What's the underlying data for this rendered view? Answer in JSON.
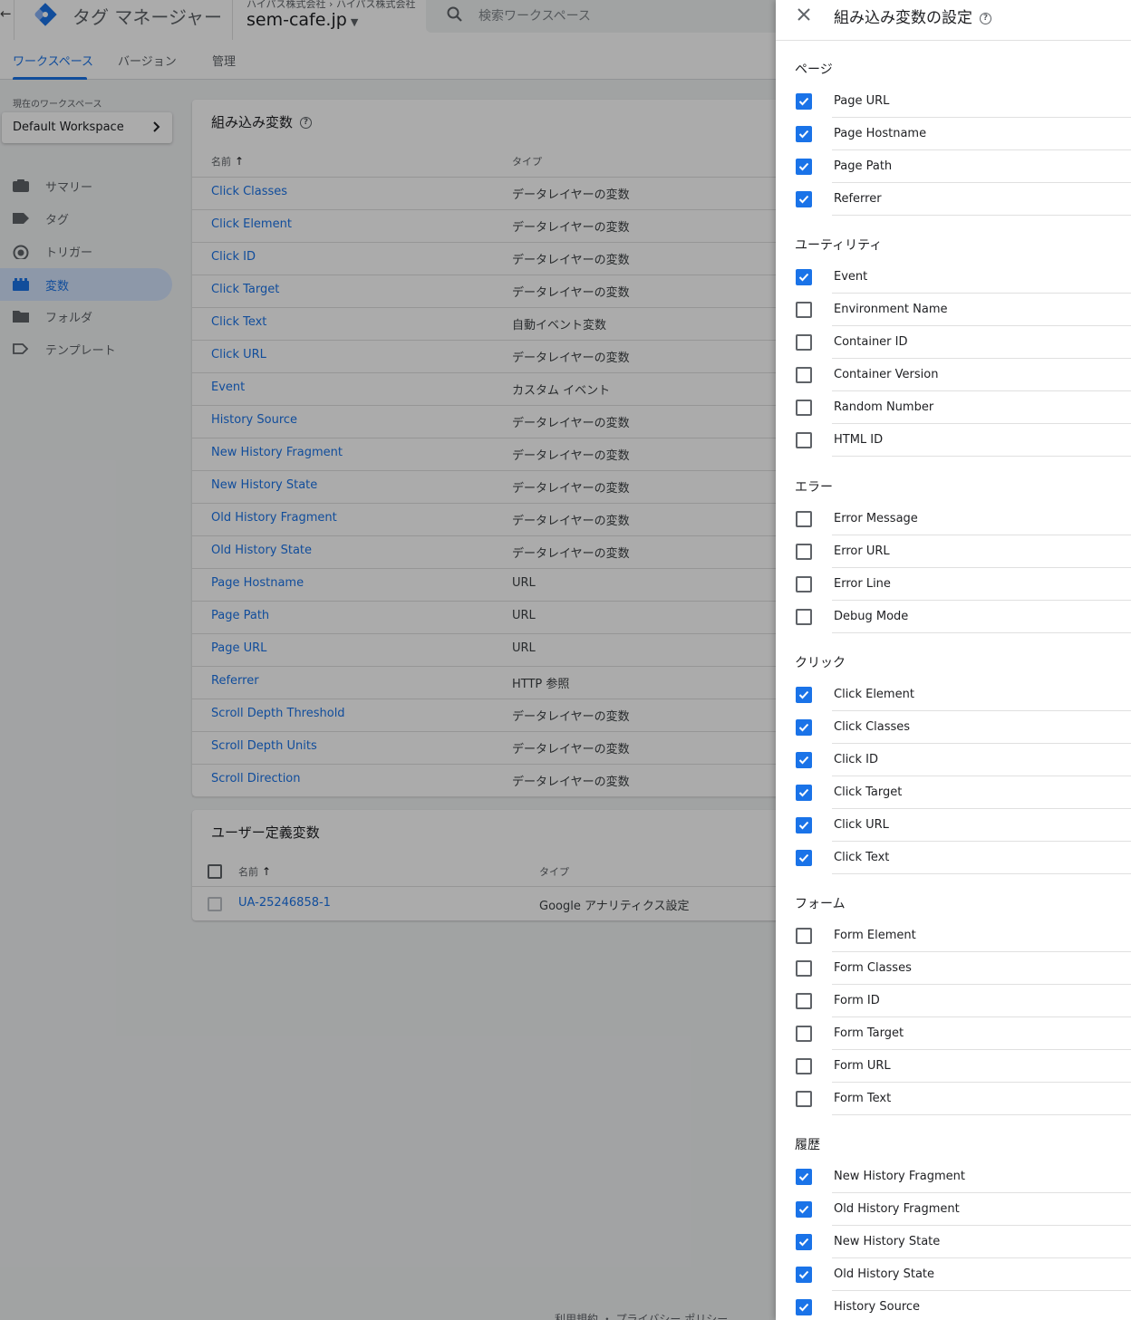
{
  "app": {
    "back_arrow": "←",
    "title": "タグ マネージャー",
    "breadcrumb": "ハイパス株式会社 › ハイパス株式会社",
    "container_name": "sem-cafe.jp",
    "search_placeholder": "検索ワークスペース",
    "accent_color": "#1a73e8"
  },
  "tabs": [
    {
      "label": "ワークスペース",
      "active": true
    },
    {
      "label": "バージョン",
      "active": false
    },
    {
      "label": "管理",
      "active": false
    }
  ],
  "workspace": {
    "label": "現在のワークスペース",
    "name": "Default Workspace"
  },
  "sidebar": {
    "items": [
      {
        "label": "サマリー",
        "icon": "briefcase-icon",
        "active": false
      },
      {
        "label": "タグ",
        "icon": "tag-icon",
        "active": false
      },
      {
        "label": "トリガー",
        "icon": "trigger-icon",
        "active": false
      },
      {
        "label": "変数",
        "icon": "variable-icon",
        "active": true
      },
      {
        "label": "フォルダ",
        "icon": "folder-icon",
        "active": false
      },
      {
        "label": "テンプレート",
        "icon": "template-icon",
        "active": false
      }
    ]
  },
  "builtin_card": {
    "title": "組み込み変数",
    "help": "?",
    "col_name": "名前",
    "col_type": "タイプ",
    "sort_arrow": "↑",
    "rows": [
      {
        "name": "Click Classes",
        "type": "データレイヤーの変数"
      },
      {
        "name": "Click Element",
        "type": "データレイヤーの変数"
      },
      {
        "name": "Click ID",
        "type": "データレイヤーの変数"
      },
      {
        "name": "Click Target",
        "type": "データレイヤーの変数"
      },
      {
        "name": "Click Text",
        "type": "自動イベント変数"
      },
      {
        "name": "Click URL",
        "type": "データレイヤーの変数"
      },
      {
        "name": "Event",
        "type": "カスタム イベント"
      },
      {
        "name": "History Source",
        "type": "データレイヤーの変数"
      },
      {
        "name": "New History Fragment",
        "type": "データレイヤーの変数"
      },
      {
        "name": "New History State",
        "type": "データレイヤーの変数"
      },
      {
        "name": "Old History Fragment",
        "type": "データレイヤーの変数"
      },
      {
        "name": "Old History State",
        "type": "データレイヤーの変数"
      },
      {
        "name": "Page Hostname",
        "type": "URL"
      },
      {
        "name": "Page Path",
        "type": "URL"
      },
      {
        "name": "Page URL",
        "type": "URL"
      },
      {
        "name": "Referrer",
        "type": "HTTP 参照"
      },
      {
        "name": "Scroll Depth Threshold",
        "type": "データレイヤーの変数"
      },
      {
        "name": "Scroll Depth Units",
        "type": "データレイヤーの変数"
      },
      {
        "name": "Scroll Direction",
        "type": "データレイヤーの変数"
      }
    ]
  },
  "user_card": {
    "title": "ユーザー定義変数",
    "col_name": "名前",
    "col_type": "タイプ",
    "sort_arrow": "↑",
    "rows": [
      {
        "name": "UA-25246858-1",
        "type": "Google アナリティクス設定"
      }
    ]
  },
  "footer": {
    "links": "利用規約 ・ プライバシー ポリシー"
  },
  "panel": {
    "title": "組み込み変数の設定",
    "help": "?",
    "sections": [
      {
        "title": "ページ",
        "items": [
          {
            "label": "Page URL",
            "checked": true
          },
          {
            "label": "Page Hostname",
            "checked": true
          },
          {
            "label": "Page Path",
            "checked": true
          },
          {
            "label": "Referrer",
            "checked": true
          }
        ]
      },
      {
        "title": "ユーティリティ",
        "items": [
          {
            "label": "Event",
            "checked": true
          },
          {
            "label": "Environment Name",
            "checked": false
          },
          {
            "label": "Container ID",
            "checked": false
          },
          {
            "label": "Container Version",
            "checked": false
          },
          {
            "label": "Random Number",
            "checked": false
          },
          {
            "label": "HTML ID",
            "checked": false
          }
        ]
      },
      {
        "title": "エラー",
        "items": [
          {
            "label": "Error Message",
            "checked": false
          },
          {
            "label": "Error URL",
            "checked": false
          },
          {
            "label": "Error Line",
            "checked": false
          },
          {
            "label": "Debug Mode",
            "checked": false
          }
        ]
      },
      {
        "title": "クリック",
        "items": [
          {
            "label": "Click Element",
            "checked": true
          },
          {
            "label": "Click Classes",
            "checked": true
          },
          {
            "label": "Click ID",
            "checked": true
          },
          {
            "label": "Click Target",
            "checked": true
          },
          {
            "label": "Click URL",
            "checked": true
          },
          {
            "label": "Click Text",
            "checked": true
          }
        ]
      },
      {
        "title": "フォーム",
        "items": [
          {
            "label": "Form Element",
            "checked": false
          },
          {
            "label": "Form Classes",
            "checked": false
          },
          {
            "label": "Form ID",
            "checked": false
          },
          {
            "label": "Form Target",
            "checked": false
          },
          {
            "label": "Form URL",
            "checked": false
          },
          {
            "label": "Form Text",
            "checked": false
          }
        ]
      },
      {
        "title": "履歴",
        "items": [
          {
            "label": "New History Fragment",
            "checked": true
          },
          {
            "label": "Old History Fragment",
            "checked": true
          },
          {
            "label": "New History State",
            "checked": true
          },
          {
            "label": "Old History State",
            "checked": true
          },
          {
            "label": "History Source",
            "checked": true
          }
        ]
      }
    ]
  }
}
